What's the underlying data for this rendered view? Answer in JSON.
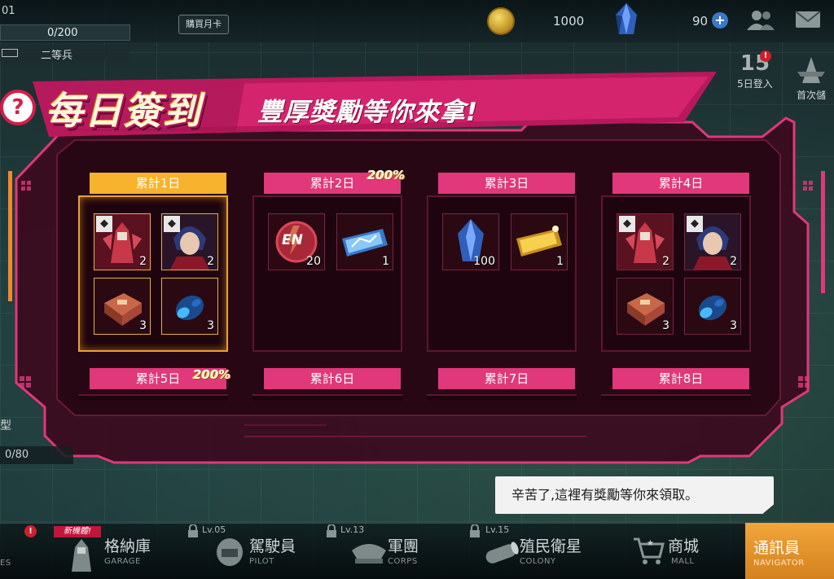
{
  "topbar": {
    "level_fragment": "01",
    "exp_text": "0/200",
    "rank_text": "二等兵",
    "monthly_card_label": "購買月卡",
    "coins": "1000",
    "gems": "90",
    "plus": "+"
  },
  "events": {
    "login_number": "15",
    "login_label": "5日登入",
    "first_label": "首次儲",
    "red_badge": "!"
  },
  "panel": {
    "title_main": "每日簽到",
    "title_sub": "豐厚獎勵等你來拿!",
    "help": "?"
  },
  "days": [
    {
      "label": "累計1日",
      "bonus": "",
      "items": [
        {
          "name": "mobile-suit",
          "qty": "2",
          "badge": "◆"
        },
        {
          "name": "pilot",
          "qty": "2",
          "badge": "◆"
        },
        {
          "name": "parts-box",
          "qty": "3"
        },
        {
          "name": "energy-cell",
          "qty": "3"
        }
      ]
    },
    {
      "label": "累計2日",
      "bonus": "200%",
      "items": [
        {
          "name": "en-token",
          "qty": "20",
          "text": "EN"
        },
        {
          "name": "blue-ticket",
          "qty": "1"
        }
      ]
    },
    {
      "label": "累計3日",
      "bonus": "",
      "items": [
        {
          "name": "crystal",
          "qty": "100"
        },
        {
          "name": "gold-ticket",
          "qty": "1"
        }
      ]
    },
    {
      "label": "累計4日",
      "bonus": "",
      "items": [
        {
          "name": "mobile-suit",
          "qty": "2",
          "badge": "◆"
        },
        {
          "name": "pilot",
          "qty": "2",
          "badge": "◆"
        },
        {
          "name": "parts-box",
          "qty": "3"
        },
        {
          "name": "energy-cell",
          "qty": "3"
        }
      ]
    },
    {
      "label": "累計5日",
      "bonus": "200%"
    },
    {
      "label": "累計6日",
      "bonus": ""
    },
    {
      "label": "累計7日",
      "bonus": ""
    },
    {
      "label": "累計8日",
      "bonus": ""
    }
  ],
  "bubble": "辛苦了,這裡有獎勵等你來領取。",
  "left": {
    "type_text": "型",
    "progress": "0/80"
  },
  "nav": {
    "new_tag": "新機體!",
    "red_dot": "!",
    "items": [
      {
        "zh": "格納庫",
        "en": "GARAGE",
        "lv": ""
      },
      {
        "zh": "駕駛員",
        "en": "PILOT",
        "lv": "Lv.05"
      },
      {
        "zh": "軍團",
        "en": "CORPS",
        "lv": "Lv.13"
      },
      {
        "zh": "殖民衛星",
        "en": "COLONY",
        "lv": "Lv.15"
      },
      {
        "zh": "商城",
        "en": "MALL",
        "lv": ""
      },
      {
        "zh": "通訊員",
        "en": "NAVIGATOR",
        "lv": ""
      }
    ],
    "left_fragment": "ES"
  },
  "colors": {
    "accent_pink": "#e0387a",
    "active_gold": "#f7b32d",
    "panel_dark": "#2a0816",
    "nav_active": "#e8952c"
  }
}
